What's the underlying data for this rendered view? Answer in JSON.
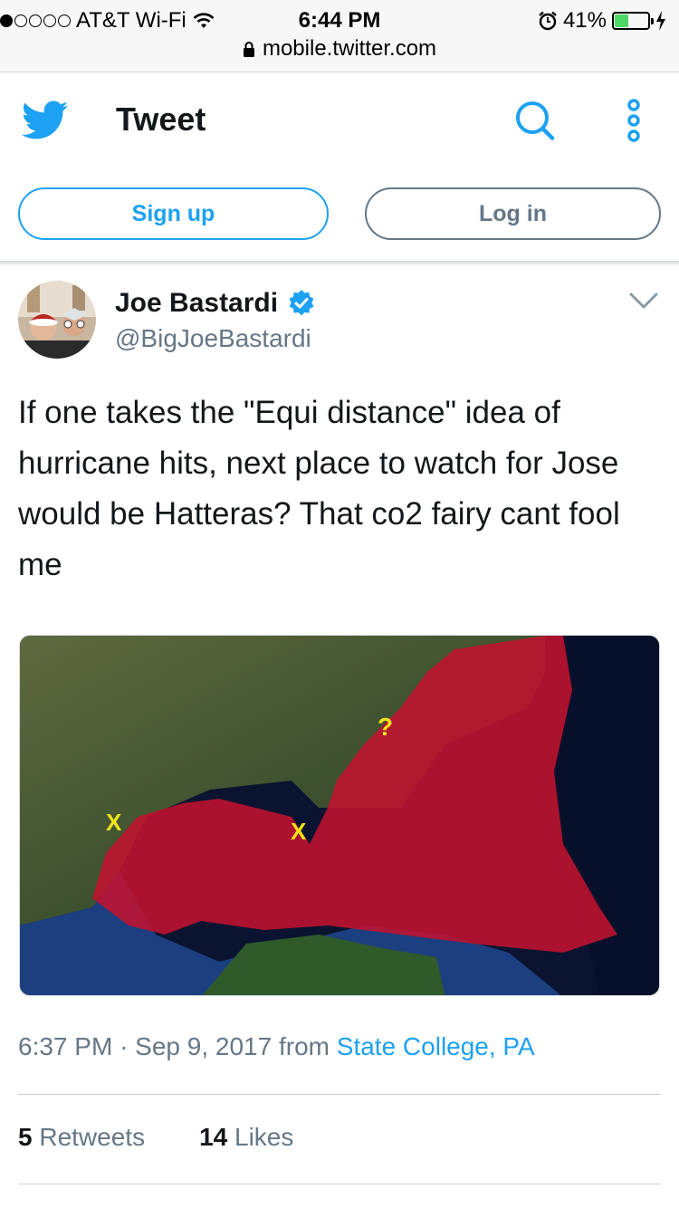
{
  "status_bar": {
    "carrier": "AT&T Wi-Fi",
    "time": "6:44 PM",
    "battery": "41%",
    "battery_level": 0.41,
    "url": "mobile.twitter.com"
  },
  "header": {
    "title": "Tweet",
    "signup_label": "Sign up",
    "login_label": "Log in"
  },
  "tweet": {
    "author_name": "Joe Bastardi",
    "author_handle": "@BigJoeBastardi",
    "text": "If one takes the \"Equi distance\" idea of hurricane hits,  next place to watch for Jose would be Hatteras? That co2 fairy cant fool me",
    "image_marks": [
      "X",
      "X",
      "?"
    ],
    "time": "6:37 PM",
    "separator": "·",
    "date": "Sep 9, 2017",
    "from_label": "from",
    "location": "State College, PA",
    "retweets_count": "5",
    "retweets_label": "Retweets",
    "likes_count": "14",
    "likes_label": "Likes"
  },
  "colors": {
    "brand": "#1da1f2",
    "secondary": "#657786",
    "text": "#14171a"
  }
}
